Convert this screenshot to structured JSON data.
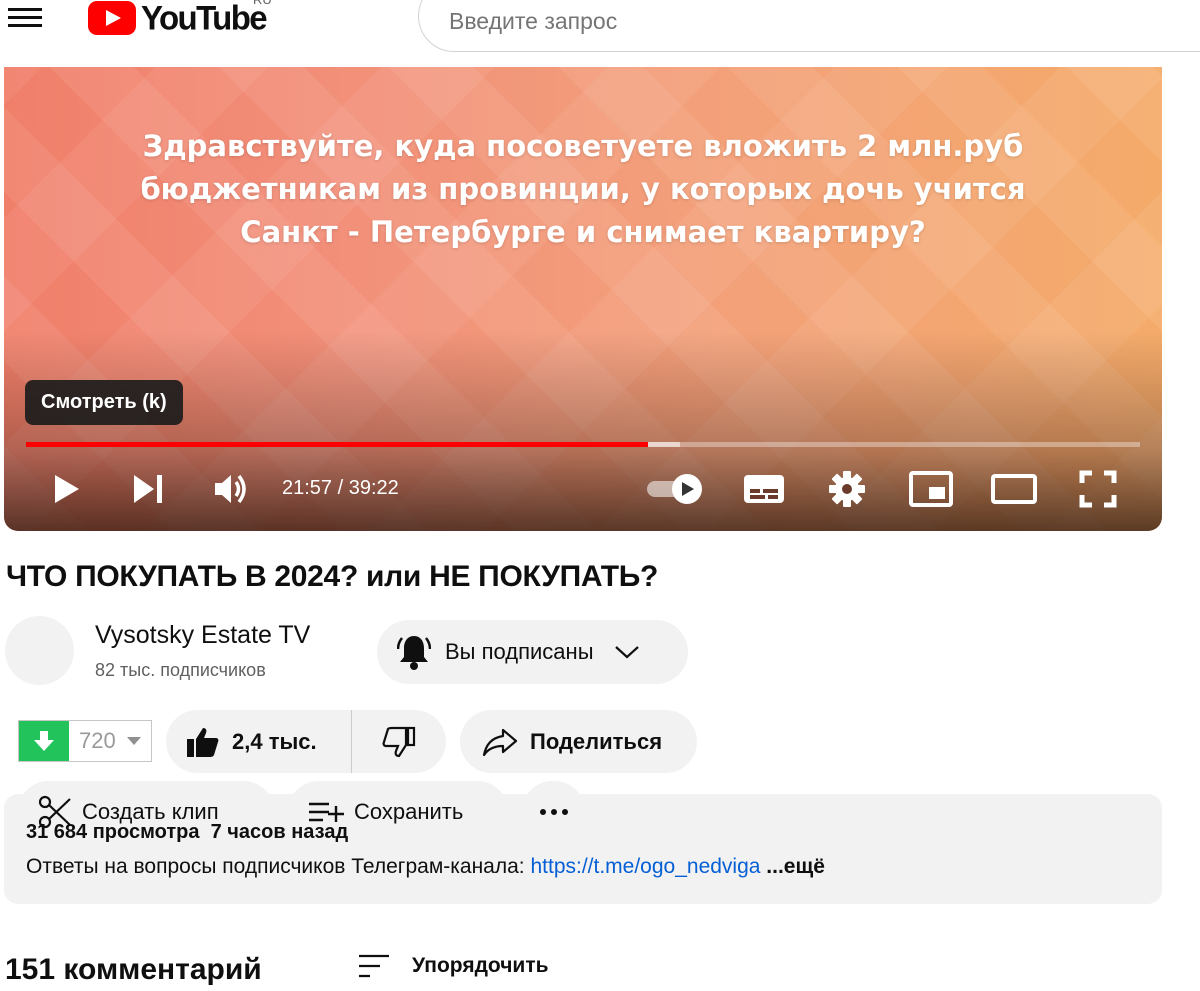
{
  "header": {
    "logo_text": "YouTube",
    "region": "RU",
    "search_placeholder": "Введите запрос"
  },
  "video": {
    "overlay_line1": "Здравствуйте, куда посоветуете вложить 2 млн.руб",
    "overlay_line2": "бюджетникам из провинции, у которых дочь учится",
    "overlay_line3": "Санкт - Петербурге и снимает квартиру?",
    "tooltip": "Смотреть (k)",
    "time": "21:57 / 39:22",
    "progress_played": 0.558,
    "progress_buffered": 0.587
  },
  "title": "ЧТО ПОКУПАТЬ В 2024? или НЕ ПОКУПАТЬ?",
  "channel": {
    "name": "Vysotsky Estate TV",
    "subscribers": "82 тыс. подписчиков",
    "subscribe_label": "Вы подписаны"
  },
  "actions": {
    "download_count": "720",
    "likes": "2,4 тыс.",
    "share": "Поделиться",
    "clip": "Создать клип",
    "save": "Сохранить"
  },
  "description": {
    "stats": "31 684 просмотра  7 часов назад",
    "text": "Ответы на вопросы подписчиков Телеграм-канала: ",
    "link": "https://t.me/ogo_nedviga",
    "more": " ...ещё"
  },
  "comments": {
    "count_label": "151 комментарий",
    "sort_label": "Упорядочить"
  },
  "colors": {
    "brand_red": "#ff0000",
    "link_blue": "#065fd4",
    "download_green": "#22c35b"
  }
}
